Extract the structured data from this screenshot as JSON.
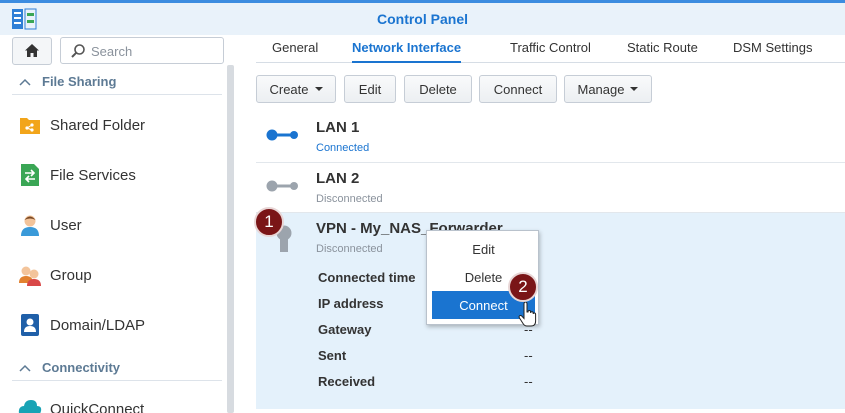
{
  "window": {
    "title": "Control Panel"
  },
  "sidebar": {
    "search_placeholder": "Search",
    "sections": [
      {
        "label": "File Sharing",
        "items": [
          {
            "label": "Shared Folder",
            "icon": "shared-folder-icon"
          },
          {
            "label": "File Services",
            "icon": "file-services-icon"
          },
          {
            "label": "User",
            "icon": "user-icon"
          },
          {
            "label": "Group",
            "icon": "group-icon"
          },
          {
            "label": "Domain/LDAP",
            "icon": "domain-ldap-icon"
          }
        ]
      },
      {
        "label": "Connectivity",
        "items": [
          {
            "label": "QuickConnect",
            "icon": "quickconnect-icon"
          }
        ]
      }
    ]
  },
  "tabs": [
    {
      "label": "General",
      "active": false
    },
    {
      "label": "Network Interface",
      "active": true
    },
    {
      "label": "Traffic Control",
      "active": false
    },
    {
      "label": "Static Route",
      "active": false
    },
    {
      "label": "DSM Settings",
      "active": false
    }
  ],
  "toolbar": {
    "create": "Create",
    "edit": "Edit",
    "delete": "Delete",
    "connect": "Connect",
    "manage": "Manage"
  },
  "interfaces": [
    {
      "name": "LAN 1",
      "status": "Connected"
    },
    {
      "name": "LAN 2",
      "status": "Disconnected"
    },
    {
      "name": "VPN - My_NAS_Forwarder",
      "status": "Disconnected",
      "details": [
        {
          "label": "Connected time",
          "value": ""
        },
        {
          "label": "IP address",
          "value": ""
        },
        {
          "label": "Gateway",
          "value": "--"
        },
        {
          "label": "Sent",
          "value": "--"
        },
        {
          "label": "Received",
          "value": "--"
        }
      ]
    }
  ],
  "context_menu": {
    "items": [
      "Edit",
      "Delete",
      "Connect"
    ],
    "highlighted": "Connect"
  },
  "markers": [
    "1",
    "2"
  ],
  "colors": {
    "accent": "#1a74d0",
    "marker": "#7a1517",
    "selected_row": "#e4f1fb",
    "connected": "#1a74d0",
    "disconnected": "#8a929c"
  }
}
